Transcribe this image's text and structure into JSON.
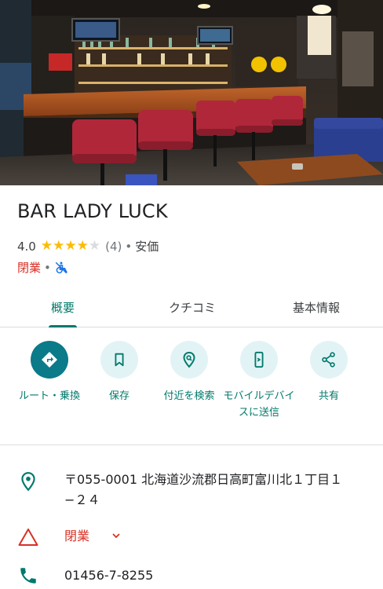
{
  "place": {
    "name": "BAR LADY LUCK",
    "rating": "4.0",
    "rating_value": 4.0,
    "stars_total": 5,
    "review_count": "(4)",
    "separator": "•",
    "price": "安価",
    "status": "閉業",
    "status_separator": "•",
    "accessibility_icon": "wheelchair-unavailable-icon"
  },
  "tabs": [
    {
      "label": "概要",
      "active": true
    },
    {
      "label": "クチコミ",
      "active": false
    },
    {
      "label": "基本情報",
      "active": false
    }
  ],
  "actions": [
    {
      "label": "ルート・乗換",
      "icon": "directions-icon"
    },
    {
      "label": "保存",
      "icon": "bookmark-icon"
    },
    {
      "label": "付近を検索",
      "icon": "nearby-search-icon"
    },
    {
      "label": "モバイルデバイスに送信",
      "icon": "send-to-phone-icon"
    },
    {
      "label": "共有",
      "icon": "share-icon"
    }
  ],
  "info": {
    "address": "〒055-0001 北海道沙流郡日高町富川北１丁目１−２４",
    "status": "閉業",
    "phone": "01456-7-8255"
  },
  "colors": {
    "accent": "#00796b",
    "primary_action": "#0b7a89",
    "action_bg": "#e2f3f6",
    "closed_red": "#d93025",
    "star": "#fbbc04"
  }
}
